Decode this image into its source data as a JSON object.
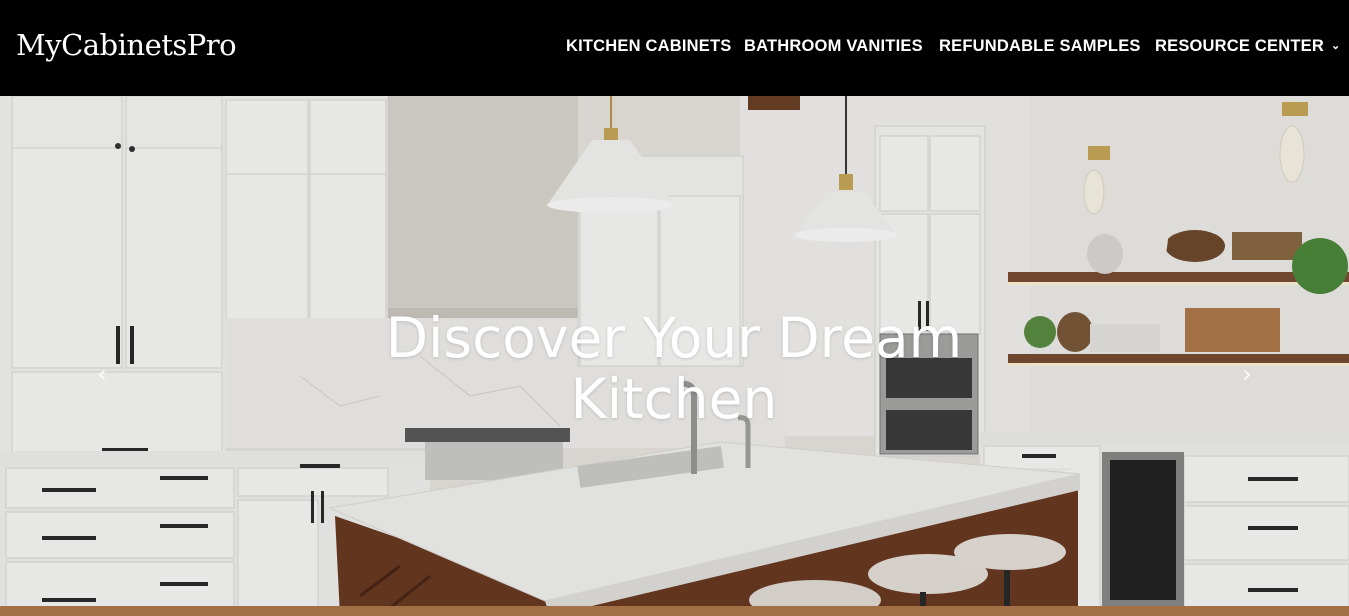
{
  "site": {
    "logo": "MyCabinetsPro"
  },
  "nav": {
    "items": [
      {
        "label": "KITCHEN CABINETS"
      },
      {
        "label": "BATHROOM VANITIES"
      },
      {
        "label": "REFUNDABLE SAMPLES"
      },
      {
        "label": "RESOURCE CENTER",
        "has_dropdown": true
      }
    ]
  },
  "hero": {
    "title_line1": "Discover Your Dream",
    "title_line2": "Kitchen",
    "prev_icon": "chevron-left-icon",
    "next_icon": "chevron-right-icon"
  },
  "colors": {
    "header_bg": "#000000",
    "text": "#ffffff",
    "cabinet_white": "#f4f4f2",
    "countertop": "#f2f2f0",
    "island_wood": "#6b3a22",
    "shelf_wood": "#7a4e32"
  }
}
